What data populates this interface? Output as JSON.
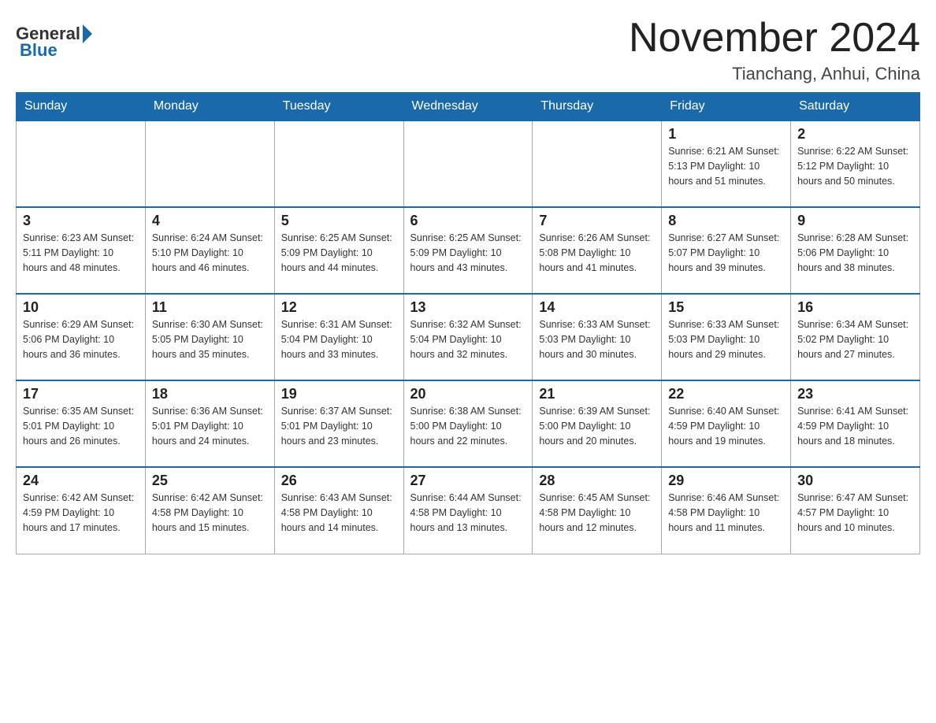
{
  "header": {
    "logo_general": "General",
    "logo_blue": "Blue",
    "month_title": "November 2024",
    "location": "Tianchang, Anhui, China"
  },
  "days_of_week": [
    "Sunday",
    "Monday",
    "Tuesday",
    "Wednesday",
    "Thursday",
    "Friday",
    "Saturday"
  ],
  "weeks": [
    [
      {
        "day": "",
        "info": ""
      },
      {
        "day": "",
        "info": ""
      },
      {
        "day": "",
        "info": ""
      },
      {
        "day": "",
        "info": ""
      },
      {
        "day": "",
        "info": ""
      },
      {
        "day": "1",
        "info": "Sunrise: 6:21 AM\nSunset: 5:13 PM\nDaylight: 10 hours\nand 51 minutes."
      },
      {
        "day": "2",
        "info": "Sunrise: 6:22 AM\nSunset: 5:12 PM\nDaylight: 10 hours\nand 50 minutes."
      }
    ],
    [
      {
        "day": "3",
        "info": "Sunrise: 6:23 AM\nSunset: 5:11 PM\nDaylight: 10 hours\nand 48 minutes."
      },
      {
        "day": "4",
        "info": "Sunrise: 6:24 AM\nSunset: 5:10 PM\nDaylight: 10 hours\nand 46 minutes."
      },
      {
        "day": "5",
        "info": "Sunrise: 6:25 AM\nSunset: 5:09 PM\nDaylight: 10 hours\nand 44 minutes."
      },
      {
        "day": "6",
        "info": "Sunrise: 6:25 AM\nSunset: 5:09 PM\nDaylight: 10 hours\nand 43 minutes."
      },
      {
        "day": "7",
        "info": "Sunrise: 6:26 AM\nSunset: 5:08 PM\nDaylight: 10 hours\nand 41 minutes."
      },
      {
        "day": "8",
        "info": "Sunrise: 6:27 AM\nSunset: 5:07 PM\nDaylight: 10 hours\nand 39 minutes."
      },
      {
        "day": "9",
        "info": "Sunrise: 6:28 AM\nSunset: 5:06 PM\nDaylight: 10 hours\nand 38 minutes."
      }
    ],
    [
      {
        "day": "10",
        "info": "Sunrise: 6:29 AM\nSunset: 5:06 PM\nDaylight: 10 hours\nand 36 minutes."
      },
      {
        "day": "11",
        "info": "Sunrise: 6:30 AM\nSunset: 5:05 PM\nDaylight: 10 hours\nand 35 minutes."
      },
      {
        "day": "12",
        "info": "Sunrise: 6:31 AM\nSunset: 5:04 PM\nDaylight: 10 hours\nand 33 minutes."
      },
      {
        "day": "13",
        "info": "Sunrise: 6:32 AM\nSunset: 5:04 PM\nDaylight: 10 hours\nand 32 minutes."
      },
      {
        "day": "14",
        "info": "Sunrise: 6:33 AM\nSunset: 5:03 PM\nDaylight: 10 hours\nand 30 minutes."
      },
      {
        "day": "15",
        "info": "Sunrise: 6:33 AM\nSunset: 5:03 PM\nDaylight: 10 hours\nand 29 minutes."
      },
      {
        "day": "16",
        "info": "Sunrise: 6:34 AM\nSunset: 5:02 PM\nDaylight: 10 hours\nand 27 minutes."
      }
    ],
    [
      {
        "day": "17",
        "info": "Sunrise: 6:35 AM\nSunset: 5:01 PM\nDaylight: 10 hours\nand 26 minutes."
      },
      {
        "day": "18",
        "info": "Sunrise: 6:36 AM\nSunset: 5:01 PM\nDaylight: 10 hours\nand 24 minutes."
      },
      {
        "day": "19",
        "info": "Sunrise: 6:37 AM\nSunset: 5:01 PM\nDaylight: 10 hours\nand 23 minutes."
      },
      {
        "day": "20",
        "info": "Sunrise: 6:38 AM\nSunset: 5:00 PM\nDaylight: 10 hours\nand 22 minutes."
      },
      {
        "day": "21",
        "info": "Sunrise: 6:39 AM\nSunset: 5:00 PM\nDaylight: 10 hours\nand 20 minutes."
      },
      {
        "day": "22",
        "info": "Sunrise: 6:40 AM\nSunset: 4:59 PM\nDaylight: 10 hours\nand 19 minutes."
      },
      {
        "day": "23",
        "info": "Sunrise: 6:41 AM\nSunset: 4:59 PM\nDaylight: 10 hours\nand 18 minutes."
      }
    ],
    [
      {
        "day": "24",
        "info": "Sunrise: 6:42 AM\nSunset: 4:59 PM\nDaylight: 10 hours\nand 17 minutes."
      },
      {
        "day": "25",
        "info": "Sunrise: 6:42 AM\nSunset: 4:58 PM\nDaylight: 10 hours\nand 15 minutes."
      },
      {
        "day": "26",
        "info": "Sunrise: 6:43 AM\nSunset: 4:58 PM\nDaylight: 10 hours\nand 14 minutes."
      },
      {
        "day": "27",
        "info": "Sunrise: 6:44 AM\nSunset: 4:58 PM\nDaylight: 10 hours\nand 13 minutes."
      },
      {
        "day": "28",
        "info": "Sunrise: 6:45 AM\nSunset: 4:58 PM\nDaylight: 10 hours\nand 12 minutes."
      },
      {
        "day": "29",
        "info": "Sunrise: 6:46 AM\nSunset: 4:58 PM\nDaylight: 10 hours\nand 11 minutes."
      },
      {
        "day": "30",
        "info": "Sunrise: 6:47 AM\nSunset: 4:57 PM\nDaylight: 10 hours\nand 10 minutes."
      }
    ]
  ]
}
